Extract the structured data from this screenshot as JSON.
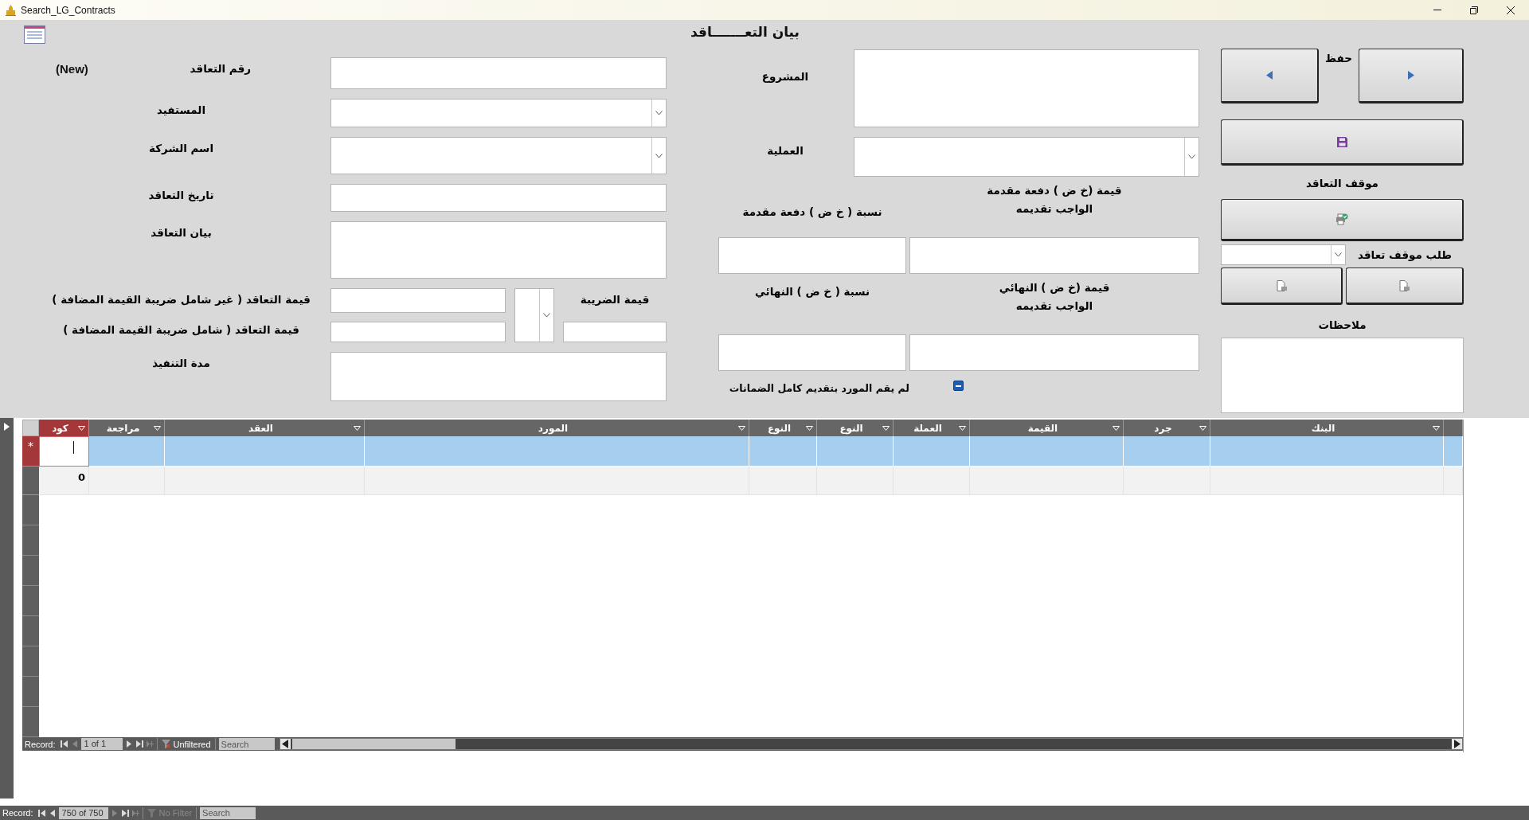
{
  "window": {
    "title": "Search_LG_Contracts"
  },
  "form": {
    "title": "بيان التعـــــــاقد",
    "record_badge": "(New)",
    "left_fields": [
      {
        "label": "رقم التعاقد",
        "kind": "text"
      },
      {
        "label": "المستفيد",
        "kind": "combo"
      },
      {
        "label": "اسم الشركة",
        "kind": "combo"
      },
      {
        "label": "تاريخ التعاقد",
        "kind": "text"
      },
      {
        "label": "بيان التعاقد",
        "kind": "memo"
      }
    ],
    "amounts": {
      "excl_label": "قيمة التعاقد ( غير شامل ضريبة القيمة المضافة )",
      "incl_label": "قيمة التعاقد ( شامل ضريبة القيمة المضافة )",
      "tax_label": "قيمة الضريبة"
    },
    "duration": {
      "label": "مدة التنفيذ"
    },
    "project": {
      "label": "المشروع"
    },
    "operation": {
      "label": "العملية"
    },
    "guarantees": [
      {
        "percent_label": "نسبة ( خ ض ) دفعة مقدمة",
        "value_lines": [
          "قيمة (خ ض ) دفعة مقدمة",
          "الواجب تقديمه"
        ]
      },
      {
        "percent_label": "نسبة ( خ ض ) النهائي",
        "value_lines": [
          "قيمة (خ ض ) النهائي",
          "الواجب تقديمه"
        ]
      }
    ],
    "incomplete_guarantees": {
      "label": "لم يقم المورد بتقديم كامل الضمانات",
      "indeterminate": true
    },
    "save_label": "حفظ",
    "status_label": "موقف التعاقد",
    "request_label": "طلب موقف تعاقد",
    "notes_label": "ملاحظات"
  },
  "subform": {
    "columns": [
      {
        "label": "البنك",
        "selected": false
      },
      {
        "label": "جرد",
        "selected": false
      },
      {
        "label": "القيمة",
        "selected": false
      },
      {
        "label": "العملة",
        "selected": false
      },
      {
        "label": "النوع",
        "selected": false
      },
      {
        "label": "النوع",
        "selected": false
      },
      {
        "label": "المورد",
        "selected": false
      },
      {
        "label": "العقد",
        "selected": false
      },
      {
        "label": "مراجعة",
        "selected": false
      },
      {
        "label": "كود",
        "selected": true
      }
    ],
    "rows": [
      {
        "kind": "new",
        "marker": "*",
        "selected": true
      },
      {
        "kind": "record",
        "code": "0",
        "selected": false
      }
    ],
    "navigation": {
      "label": "Record:",
      "position": "1 of 1",
      "filter": {
        "label": "Unfiltered",
        "disabled": false
      },
      "search": {
        "placeholder": "Search"
      }
    }
  },
  "navigation": {
    "label": "Record:",
    "position": "750 of 750",
    "filter": {
      "label": "No Filter",
      "disabled": true
    },
    "search": {
      "placeholder": "Search"
    }
  }
}
